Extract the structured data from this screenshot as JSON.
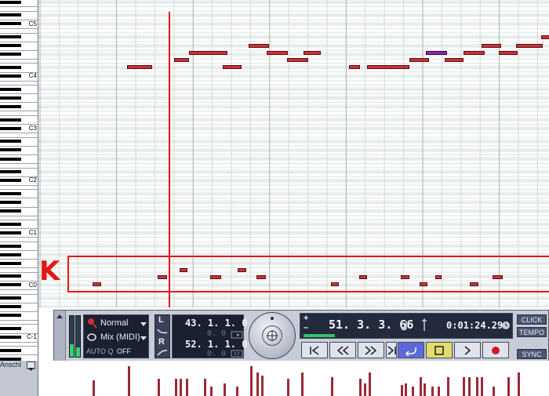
{
  "keyboard": {
    "octave_labels": [
      "C5",
      "C4",
      "C3",
      "C2",
      "C1",
      "C0",
      "C-1"
    ]
  },
  "annotation": {
    "letter": "K"
  },
  "transport": {
    "mode_left": "Normal",
    "mix_mode": "Mix (MIDI)",
    "autoq_label": "AUTO Q",
    "autoq_value": "OFF",
    "left_locator": "43. 1. 1.   0",
    "left_locator_sub": "0.   0",
    "right_locator": "52. 1. 1.   0",
    "right_locator_sub": "0.   0",
    "l_label": "L",
    "r_label": "R",
    "position_bars": "51. 3. 3. 66",
    "position_time": "0:01:24.294",
    "click_label": "CLICK",
    "tempo_label": "TEMPO",
    "sync_label": "SYNC",
    "plus": "+",
    "minus": "–"
  },
  "bottom": {
    "controller_lane": "Anschl"
  },
  "colors": {
    "note": "#c8323a",
    "marker": "#e01818",
    "grid_line": "#c9d3d0"
  }
}
